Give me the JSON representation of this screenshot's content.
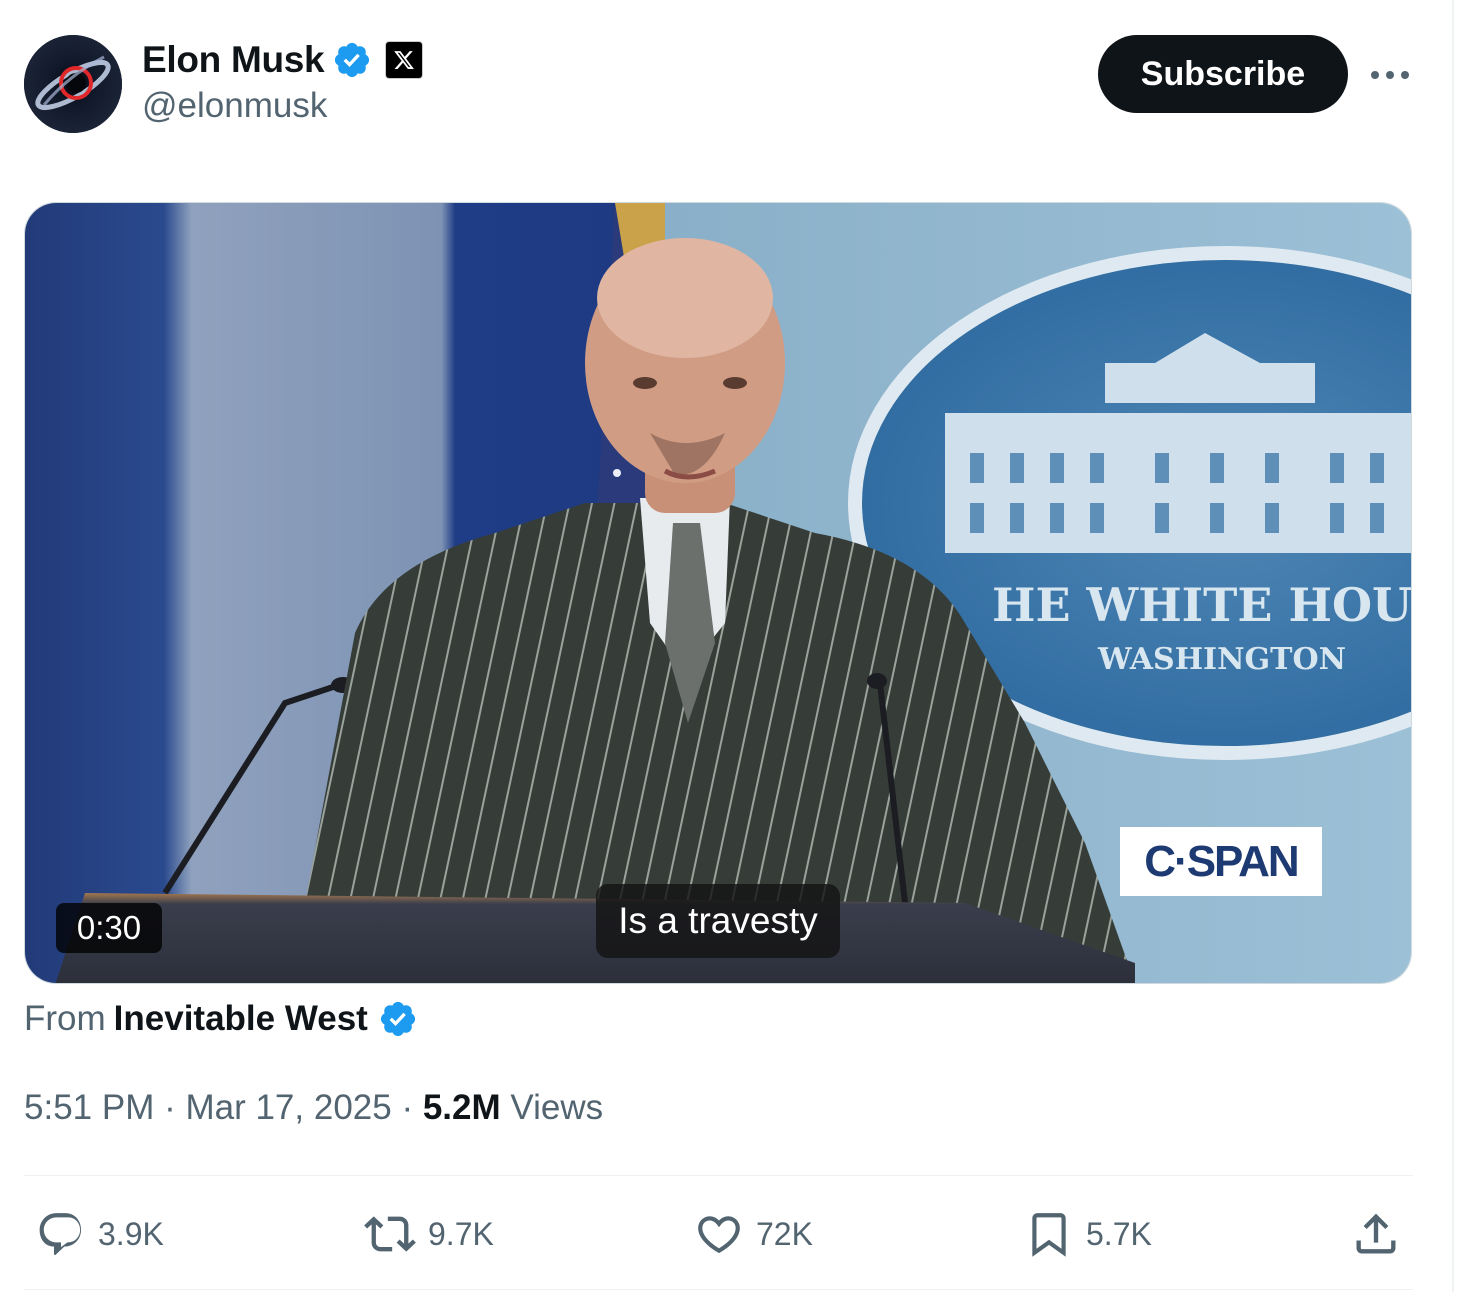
{
  "author": {
    "name": "Elon Musk",
    "handle": "@elonmusk",
    "verified_icon": "verified-badge-icon",
    "affiliate_icon": "x-logo-icon"
  },
  "header": {
    "subscribe_label": "Subscribe",
    "more_icon": "more-dots-icon"
  },
  "video": {
    "duration": "0:30",
    "caption": "Is a travesty",
    "watermark": "C·SPAN",
    "seal_title": "HE WHITE HOU",
    "seal_subtitle": "WASHINGTON"
  },
  "source": {
    "prefix": "From",
    "name": "Inevitable West"
  },
  "meta": {
    "time": "5:51 PM",
    "separator": " · ",
    "date": "Mar 17, 2025",
    "views_count": "5.2M",
    "views_label": " Views"
  },
  "actions": {
    "replies": "3.9K",
    "reposts": "9.7K",
    "likes": "72K",
    "bookmarks": "5.7K"
  },
  "colors": {
    "verified": "#1d9bf0",
    "text": "#0f1419",
    "muted": "#536471"
  }
}
